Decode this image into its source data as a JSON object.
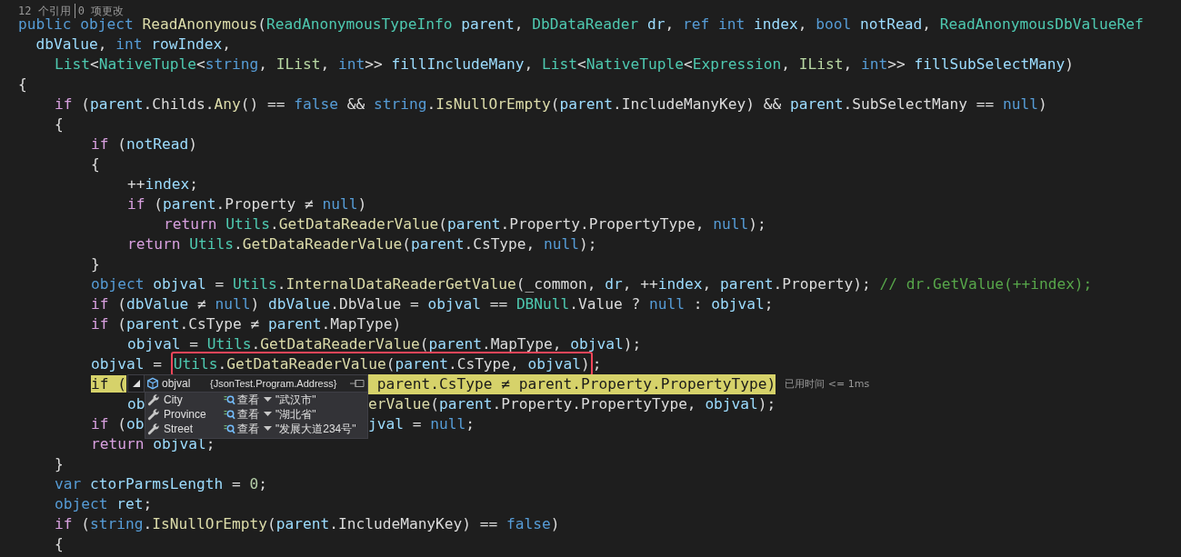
{
  "codelens": [
    "12 个引用",
    "0 项更改"
  ],
  "lines": [
    {
      "current": false,
      "tokens": [
        {
          "text": "public object ",
          "kind": "kw"
        },
        {
          "text": "ReadAnonymous",
          "kind": "fn"
        },
        {
          "text": "(",
          "kind": "p"
        },
        {
          "text": "ReadAnonymousTypeInfo ",
          "kind": "type"
        },
        {
          "text": "parent",
          "kind": "var"
        },
        {
          "text": ", ",
          "kind": "p"
        },
        {
          "text": "DbDataReader ",
          "kind": "type"
        },
        {
          "text": "dr",
          "kind": "var"
        },
        {
          "text": ", ",
          "kind": "p"
        },
        {
          "text": "ref int ",
          "kind": "kw"
        },
        {
          "text": "index",
          "kind": "var"
        },
        {
          "text": ", ",
          "kind": "p"
        },
        {
          "text": "bool ",
          "kind": "kw"
        },
        {
          "text": "notRead",
          "kind": "var"
        },
        {
          "text": ", ",
          "kind": "p"
        },
        {
          "text": "ReadAnonymousDbValueRef",
          "kind": "type"
        }
      ]
    },
    {
      "current": false,
      "tokens": [
        {
          "text": "  dbValue",
          "kind": "var"
        },
        {
          "text": ", ",
          "kind": "p"
        },
        {
          "text": "int ",
          "kind": "kw"
        },
        {
          "text": "rowIndex",
          "kind": "var"
        },
        {
          "text": ",",
          "kind": "p"
        }
      ]
    },
    {
      "current": false,
      "tokens": [
        {
          "text": "\tList",
          "kind": "type"
        },
        {
          "text": "<",
          "kind": "p"
        },
        {
          "text": "NativeTuple",
          "kind": "type"
        },
        {
          "text": "<",
          "kind": "p"
        },
        {
          "text": "string",
          "kind": "kw"
        },
        {
          "text": ", ",
          "kind": "p"
        },
        {
          "text": "IList",
          "kind": "iface"
        },
        {
          "text": ", ",
          "kind": "p"
        },
        {
          "text": "int",
          "kind": "kw"
        },
        {
          "text": ">> ",
          "kind": "p"
        },
        {
          "text": "fillIncludeMany",
          "kind": "var"
        },
        {
          "text": ", ",
          "kind": "p"
        },
        {
          "text": "List",
          "kind": "type"
        },
        {
          "text": "<",
          "kind": "p"
        },
        {
          "text": "NativeTuple",
          "kind": "type"
        },
        {
          "text": "<",
          "kind": "p"
        },
        {
          "text": "Expression",
          "kind": "type"
        },
        {
          "text": ", ",
          "kind": "p"
        },
        {
          "text": "IList",
          "kind": "iface"
        },
        {
          "text": ", ",
          "kind": "p"
        },
        {
          "text": "int",
          "kind": "kw"
        },
        {
          "text": ">> ",
          "kind": "p"
        },
        {
          "text": "fillSubSelectMany",
          "kind": "var"
        },
        {
          "text": ")",
          "kind": "p"
        }
      ]
    },
    {
      "current": false,
      "tokens": [
        {
          "text": "{",
          "kind": "p"
        }
      ]
    },
    {
      "current": false,
      "tokens": [
        {
          "text": "\tif",
          "kind": "ctl"
        },
        {
          "text": " (",
          "kind": "p"
        },
        {
          "text": "parent",
          "kind": "var"
        },
        {
          "text": ".Childs.",
          "kind": "p"
        },
        {
          "text": "Any",
          "kind": "fn"
        },
        {
          "text": "() == ",
          "kind": "p"
        },
        {
          "text": "false",
          "kind": "kw"
        },
        {
          "text": " && ",
          "kind": "p"
        },
        {
          "text": "string",
          "kind": "kw"
        },
        {
          "text": ".",
          "kind": "p"
        },
        {
          "text": "IsNullOrEmpty",
          "kind": "fn"
        },
        {
          "text": "(",
          "kind": "p"
        },
        {
          "text": "parent",
          "kind": "var"
        },
        {
          "text": ".IncludeManyKey) && ",
          "kind": "p"
        },
        {
          "text": "parent",
          "kind": "var"
        },
        {
          "text": ".SubSelectMany == ",
          "kind": "p"
        },
        {
          "text": "null",
          "kind": "kw"
        },
        {
          "text": ")",
          "kind": "p"
        }
      ]
    },
    {
      "current": false,
      "tokens": [
        {
          "text": "\t{",
          "kind": "p"
        }
      ]
    },
    {
      "current": false,
      "tokens": [
        {
          "text": "\t\tif",
          "kind": "ctl"
        },
        {
          "text": " (",
          "kind": "p"
        },
        {
          "text": "notRead",
          "kind": "var"
        },
        {
          "text": ")",
          "kind": "p"
        }
      ]
    },
    {
      "current": false,
      "tokens": [
        {
          "text": "\t\t{",
          "kind": "p"
        }
      ]
    },
    {
      "current": false,
      "tokens": [
        {
          "text": "\t\t\t++",
          "kind": "p"
        },
        {
          "text": "index",
          "kind": "var"
        },
        {
          "text": ";",
          "kind": "p"
        }
      ]
    },
    {
      "current": false,
      "tokens": [
        {
          "text": "\t\t\tif",
          "kind": "ctl"
        },
        {
          "text": " (",
          "kind": "p"
        },
        {
          "text": "parent",
          "kind": "var"
        },
        {
          "text": ".Property ≠ ",
          "kind": "p"
        },
        {
          "text": "null",
          "kind": "kw"
        },
        {
          "text": ")",
          "kind": "p"
        }
      ]
    },
    {
      "current": false,
      "tokens": [
        {
          "text": "\t\t\t\treturn ",
          "kind": "ctl"
        },
        {
          "text": "Utils",
          "kind": "type"
        },
        {
          "text": ".",
          "kind": "p"
        },
        {
          "text": "GetDataReaderValue",
          "kind": "fn"
        },
        {
          "text": "(",
          "kind": "p"
        },
        {
          "text": "parent",
          "kind": "var"
        },
        {
          "text": ".Property.PropertyType, ",
          "kind": "p"
        },
        {
          "text": "null",
          "kind": "kw"
        },
        {
          "text": ");",
          "kind": "p"
        }
      ]
    },
    {
      "current": false,
      "tokens": [
        {
          "text": "\t\t\treturn ",
          "kind": "ctl"
        },
        {
          "text": "Utils",
          "kind": "type"
        },
        {
          "text": ".",
          "kind": "p"
        },
        {
          "text": "GetDataReaderValue",
          "kind": "fn"
        },
        {
          "text": "(",
          "kind": "p"
        },
        {
          "text": "parent",
          "kind": "var"
        },
        {
          "text": ".CsType, ",
          "kind": "p"
        },
        {
          "text": "null",
          "kind": "kw"
        },
        {
          "text": ");",
          "kind": "p"
        }
      ]
    },
    {
      "current": false,
      "tokens": [
        {
          "text": "\t\t}",
          "kind": "p"
        }
      ]
    },
    {
      "current": false,
      "tokens": [
        {
          "text": "\t\tobject ",
          "kind": "kw"
        },
        {
          "text": "objval",
          "kind": "var"
        },
        {
          "text": " = ",
          "kind": "p"
        },
        {
          "text": "Utils",
          "kind": "type"
        },
        {
          "text": ".",
          "kind": "p"
        },
        {
          "text": "InternalDataReaderGetValue",
          "kind": "fn"
        },
        {
          "text": "(_common, ",
          "kind": "p"
        },
        {
          "text": "dr",
          "kind": "var"
        },
        {
          "text": ", ++",
          "kind": "p"
        },
        {
          "text": "index",
          "kind": "var"
        },
        {
          "text": ", ",
          "kind": "p"
        },
        {
          "text": "parent",
          "kind": "var"
        },
        {
          "text": ".Property); ",
          "kind": "p"
        },
        {
          "text": "// dr.GetValue(++index);",
          "kind": "cm"
        }
      ]
    },
    {
      "current": false,
      "tokens": [
        {
          "text": "\t\tif",
          "kind": "ctl"
        },
        {
          "text": " (",
          "kind": "p"
        },
        {
          "text": "dbValue",
          "kind": "var"
        },
        {
          "text": " ≠ ",
          "kind": "p"
        },
        {
          "text": "null",
          "kind": "kw"
        },
        {
          "text": ") ",
          "kind": "p"
        },
        {
          "text": "dbValue",
          "kind": "var"
        },
        {
          "text": ".DbValue = ",
          "kind": "p"
        },
        {
          "text": "objval",
          "kind": "var"
        },
        {
          "text": " == ",
          "kind": "p"
        },
        {
          "text": "DBNull",
          "kind": "type"
        },
        {
          "text": ".Value ? ",
          "kind": "p"
        },
        {
          "text": "null",
          "kind": "kw"
        },
        {
          "text": " : ",
          "kind": "p"
        },
        {
          "text": "objval",
          "kind": "var"
        },
        {
          "text": ";",
          "kind": "p"
        }
      ]
    },
    {
      "current": false,
      "tokens": [
        {
          "text": "\t\tif",
          "kind": "ctl"
        },
        {
          "text": " (",
          "kind": "p"
        },
        {
          "text": "parent",
          "kind": "var"
        },
        {
          "text": ".CsType ≠ ",
          "kind": "p"
        },
        {
          "text": "parent",
          "kind": "var"
        },
        {
          "text": ".MapType)",
          "kind": "p"
        }
      ]
    },
    {
      "current": false,
      "tokens": [
        {
          "text": "\t\t\tobjval",
          "kind": "var"
        },
        {
          "text": " = ",
          "kind": "p"
        },
        {
          "text": "Utils",
          "kind": "type"
        },
        {
          "text": ".",
          "kind": "p"
        },
        {
          "text": "GetDataReaderValue",
          "kind": "fn"
        },
        {
          "text": "(",
          "kind": "p"
        },
        {
          "text": "parent",
          "kind": "var"
        },
        {
          "text": ".MapType, ",
          "kind": "p"
        },
        {
          "text": "objval",
          "kind": "var"
        },
        {
          "text": ");",
          "kind": "p"
        }
      ]
    },
    {
      "current": false,
      "tokens": [
        {
          "text": "\t\tobjval",
          "kind": "var"
        },
        {
          "text": " = ",
          "kind": "p"
        }
      ],
      "marked": [
        {
          "text": "Utils",
          "kind": "type"
        },
        {
          "text": ".",
          "kind": "p"
        },
        {
          "text": "GetDataReaderValue",
          "kind": "fn"
        },
        {
          "text": "(",
          "kind": "p"
        },
        {
          "text": "parent",
          "kind": "var"
        },
        {
          "text": ".CsType, ",
          "kind": "p"
        },
        {
          "text": "objval",
          "kind": "var"
        },
        {
          "text": ")",
          "kind": "p"
        }
      ],
      "tail": [
        {
          "text": ";",
          "kind": "p"
        }
      ]
    },
    {
      "current": true,
      "tokens": [
        {
          "text": "\t\tif",
          "kind": "ctl"
        },
        {
          "text": " (",
          "kind": "p"
        }
      ],
      "after_tip": [
        {
          "text": " parent",
          "kind": "var"
        },
        {
          "text": ".CsType ≠ ",
          "kind": "p"
        },
        {
          "text": "parent",
          "kind": "var"
        },
        {
          "text": ".Property.PropertyType)",
          "kind": "p"
        }
      ],
      "hint": "已用时间 <= 1ms"
    },
    {
      "current": false,
      "tokens": [
        {
          "text": "\t\t\tob",
          "kind": "var"
        }
      ],
      "after_tip": [
        {
          "text": "erValue",
          "kind": "fn"
        },
        {
          "text": "(",
          "kind": "p"
        },
        {
          "text": "parent",
          "kind": "var"
        },
        {
          "text": ".Property.PropertyType, ",
          "kind": "p"
        },
        {
          "text": "objval",
          "kind": "var"
        },
        {
          "text": ");",
          "kind": "p"
        }
      ]
    },
    {
      "current": false,
      "tokens": [
        {
          "text": "\t\tif",
          "kind": "ctl"
        },
        {
          "text": " (",
          "kind": "p"
        },
        {
          "text": "ob",
          "kind": "var"
        }
      ],
      "after_tip": [
        {
          "text": "jval",
          "kind": "var"
        },
        {
          "text": " = ",
          "kind": "p"
        },
        {
          "text": "null",
          "kind": "kw"
        },
        {
          "text": ";",
          "kind": "p"
        }
      ]
    },
    {
      "current": false,
      "tokens": [
        {
          "text": "\t\treturn ",
          "kind": "ctl"
        },
        {
          "text": "objval",
          "kind": "var"
        },
        {
          "text": ";",
          "kind": "p"
        }
      ]
    },
    {
      "current": false,
      "tokens": [
        {
          "text": "\t}",
          "kind": "p"
        }
      ]
    },
    {
      "current": false,
      "tokens": [
        {
          "text": "\tvar ",
          "kind": "kw"
        },
        {
          "text": "ctorParmsLength",
          "kind": "var"
        },
        {
          "text": " = ",
          "kind": "p"
        },
        {
          "text": "0",
          "kind": "num"
        },
        {
          "text": ";",
          "kind": "p"
        }
      ]
    },
    {
      "current": false,
      "tokens": [
        {
          "text": "\tobject ",
          "kind": "kw"
        },
        {
          "text": "ret",
          "kind": "var"
        },
        {
          "text": ";",
          "kind": "p"
        }
      ]
    },
    {
      "current": false,
      "tokens": [
        {
          "text": "\tif",
          "kind": "ctl"
        },
        {
          "text": " (",
          "kind": "p"
        },
        {
          "text": "string",
          "kind": "kw"
        },
        {
          "text": ".",
          "kind": "p"
        },
        {
          "text": "IsNullOrEmpty",
          "kind": "fn"
        },
        {
          "text": "(",
          "kind": "p"
        },
        {
          "text": "parent",
          "kind": "var"
        },
        {
          "text": ".IncludeManyKey) == ",
          "kind": "p"
        },
        {
          "text": "false",
          "kind": "kw"
        },
        {
          "text": ")",
          "kind": "p"
        }
      ]
    },
    {
      "current": false,
      "tokens": [
        {
          "text": "\t{",
          "kind": "p"
        }
      ]
    }
  ],
  "datatip": {
    "expanded": true,
    "name": "objval",
    "value": "{JsonTest.Program.Address}",
    "members": [
      {
        "name": "City",
        "view_label": "查看",
        "value": "\"武汉市\""
      },
      {
        "name": "Province",
        "view_label": "查看",
        "value": "\"湖北省\""
      },
      {
        "name": "Street",
        "view_label": "查看",
        "value": "\"发展大道234号\""
      }
    ]
  }
}
